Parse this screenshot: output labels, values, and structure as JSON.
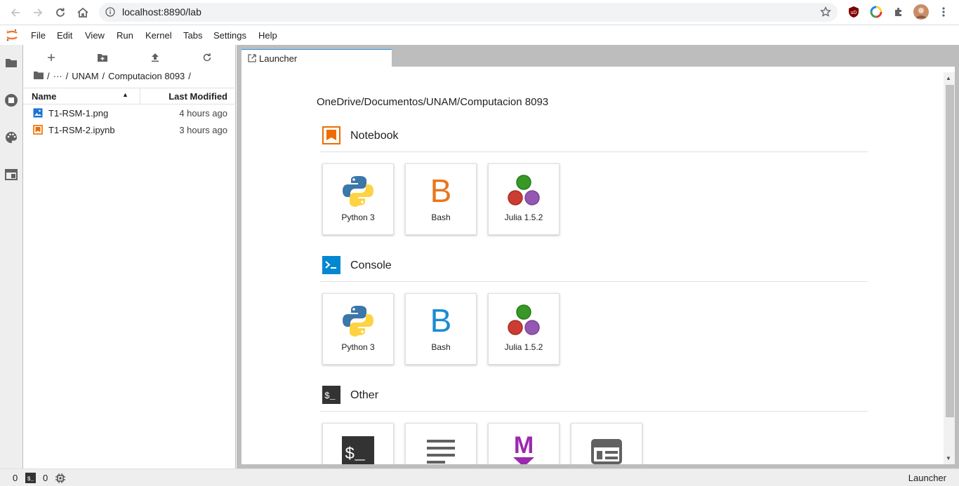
{
  "browser": {
    "url": "localhost:8890/lab"
  },
  "menu": {
    "items": [
      "File",
      "Edit",
      "View",
      "Run",
      "Kernel",
      "Tabs",
      "Settings",
      "Help"
    ]
  },
  "file_browser": {
    "breadcrumbs": [
      "/",
      "···",
      "/",
      "UNAM",
      "/",
      "Computacion 8093",
      "/"
    ],
    "columns": {
      "name": "Name",
      "modified": "Last Modified"
    },
    "files": [
      {
        "name": "T1-RSM-1.png",
        "modified": "4 hours ago",
        "icon": "image-file-icon"
      },
      {
        "name": "T1-RSM-2.ipynb",
        "modified": "3 hours ago",
        "icon": "notebook-file-icon"
      }
    ]
  },
  "tab": {
    "label": "Launcher"
  },
  "launcher": {
    "cwd": "OneDrive/Documentos/UNAM/Computacion 8093",
    "sections": {
      "notebook": {
        "title": "Notebook",
        "kernels": [
          "Python 3",
          "Bash",
          "Julia 1.5.2"
        ]
      },
      "console": {
        "title": "Console",
        "kernels": [
          "Python 3",
          "Bash",
          "Julia 1.5.2"
        ]
      },
      "other": {
        "title": "Other"
      }
    },
    "bash_letter": "B",
    "markdown_letter": "M",
    "terminal_glyph": "$_",
    "colors": {
      "bash_notebook": "#e8761d",
      "bash_console": "#1a8bd6",
      "markdown": "#9c27b0"
    }
  },
  "status": {
    "left_count": "0",
    "terminal_glyph": "$_",
    "kernel_count": "0",
    "right": "Launcher"
  }
}
